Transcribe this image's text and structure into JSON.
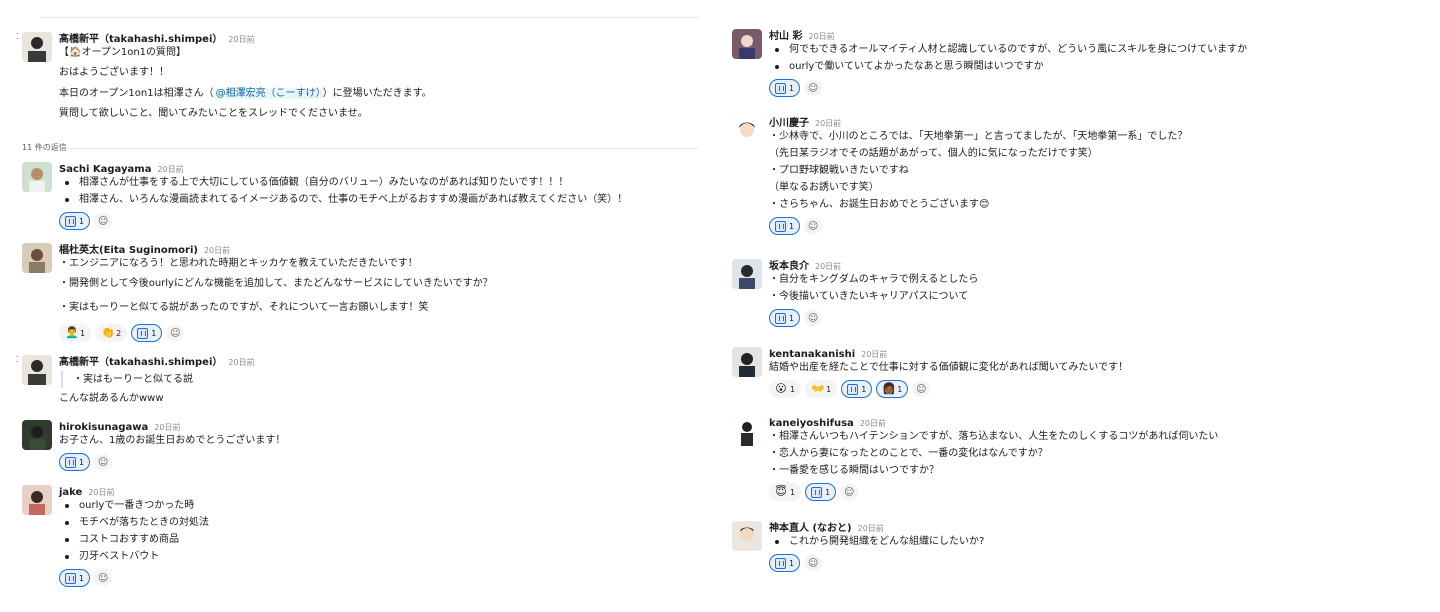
{
  "left": {
    "parent": {
      "name": "髙橋新平（takahashi.shimpei）",
      "time": "20日前",
      "lines": [
        "【🏠オープン1on1の質問】",
        "おはようございます！！",
        "本日のオープン1on1は相澤さん（",
        "）に登場いただきます。",
        "質問して欲しいこと、聞いてみたいことをスレッドでくださいませ。"
      ],
      "mention": "@相澤宏亮（こーすけ）"
    },
    "reply_count": "11 件の返信",
    "messages": [
      {
        "name": "Sachi Kagayama",
        "time": "20日前",
        "lines": [
          "相澤さんが仕事をする上で大切にしている価値観（自分のバリュー）みたいなのがあれば知りたいです！！！",
          "相澤さん、いろんな漫画読まれてるイメージあるので、仕事のモチベ上がるおすすめ漫画があれば教えてください（笑）！"
        ],
        "reactions": [
          {
            "emoji": "shirt",
            "count": "1",
            "mine": true
          }
        ]
      },
      {
        "name": "椙杜英太(Eita Suginomori)",
        "time": "20日前",
        "lines": [
          "・エンジニアになろう！と思われた時期とキッカケを教えていただきたいです！",
          "・開発側として今後ourlyにどんな機能を追加して、またどんなサービスにしていきたいですか？",
          "・実はもーりーと似てる説があったのですが、それについて一言お願いします！笑"
        ],
        "reactions": [
          {
            "emoji": "👨‍🦱",
            "count": "1",
            "mine": false
          },
          {
            "emoji": "👏",
            "count": "2",
            "mine": false
          },
          {
            "emoji": "shirt",
            "count": "1",
            "mine": true
          }
        ]
      },
      {
        "name": "髙橋新平（takahashi.shimpei）",
        "time": "20日前",
        "quote": "・実はもーりーと似てる説",
        "lines": [
          "こんな説あるんかwww"
        ]
      },
      {
        "name": "hirokisunagawa",
        "time": "20日前",
        "lines": [
          "お子さん、1歳のお誕生日おめでとうございます！"
        ],
        "reactions": [
          {
            "emoji": "shirt",
            "count": "1",
            "mine": true
          }
        ]
      },
      {
        "name": "jake",
        "time": "20日前",
        "lines": [
          "ourlyで一番きつかった時",
          "モチベが落ちたときの対処法",
          "コストコおすすめ商品",
          "刃牙ベストバウト"
        ],
        "reactions": [
          {
            "emoji": "shirt",
            "count": "1",
            "mine": true
          }
        ]
      }
    ]
  },
  "right": {
    "messages": [
      {
        "name": "村山 彩",
        "time": "20日前",
        "lines": [
          "何でもできるオールマイティ人材と認識しているのですが、どういう風にスキルを身につけていますか",
          "ourlyで働いていてよかったなあと思う瞬間はいつですか"
        ],
        "reactions": [
          {
            "emoji": "shirt",
            "count": "1",
            "mine": true
          }
        ]
      },
      {
        "name": "小川慶子",
        "time": "20日前",
        "lines": [
          "・少林寺で、小川のところでは、「天地拳第一」と言ってましたが、「天地拳第一系」でした？",
          "（先日某ラジオでその話題があがって、個人的に気になっただけです笑）",
          "・プロ野球観戦いきたいですね",
          "（単なるお誘いです笑）",
          "・さらちゃん、お誕生日おめでとうございます😊"
        ],
        "reactions": [
          {
            "emoji": "shirt",
            "count": "1",
            "mine": true
          }
        ]
      },
      {
        "name": "坂本良介",
        "time": "20日前",
        "lines": [
          "・自分をキングダムのキャラで例えるとしたら",
          "・今後描いていきたいキャリアパスについて"
        ],
        "reactions": [
          {
            "emoji": "shirt",
            "count": "1",
            "mine": true
          }
        ]
      },
      {
        "name": "kentanakanishi",
        "time": "20日前",
        "lines": [
          "結婚や出産を経たことで仕事に対する価値観に変化があれば聞いてみたいです！"
        ],
        "reactions": [
          {
            "emoji": "😮",
            "count": "1",
            "mine": false
          },
          {
            "emoji": "👐",
            "count": "1",
            "mine": false
          },
          {
            "emoji": "shirt",
            "count": "1",
            "mine": true
          },
          {
            "emoji": "👩🏾",
            "count": "1",
            "mine": true
          }
        ]
      },
      {
        "name": "kaneiyoshifusa",
        "time": "20日前",
        "lines": [
          "・相澤さんいつもハイテンションですが、落ち込まない、人生をたのしくするコツがあれば伺いたい",
          "・恋人から妻になったとのことで、一番の変化はなんですか？",
          "・一番愛を感じる瞬間はいつですか？"
        ],
        "reactions": [
          {
            "emoji": "😇",
            "count": "1",
            "mine": false
          },
          {
            "emoji": "shirt",
            "count": "1",
            "mine": true
          }
        ]
      },
      {
        "name": "神本直人 (なおと)",
        "time": "20日前",
        "lines": [
          "これから開発組織をどんな組織にしたいか?"
        ],
        "reactions": [
          {
            "emoji": "shirt",
            "count": "1",
            "mine": true
          }
        ]
      }
    ]
  },
  "icons": {
    "add_reaction": "add-reaction-icon",
    "reaction_shirt": "shirt-emoji-icon"
  },
  "colors": {
    "mention": "#1264a3",
    "mine_reaction_border": "#1d6fd1"
  }
}
